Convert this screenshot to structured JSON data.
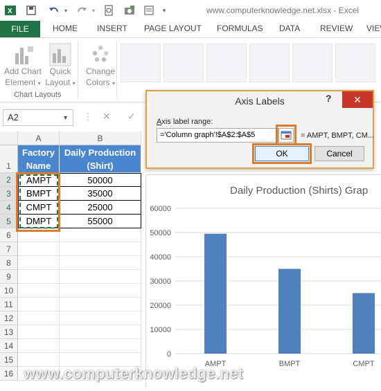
{
  "app": {
    "title": "www.computerknowledge.net.xlsx - Excel"
  },
  "tabs": [
    "FILE",
    "HOME",
    "INSERT",
    "PAGE LAYOUT",
    "FORMULAS",
    "DATA",
    "REVIEW",
    "VIEW"
  ],
  "ribbon": {
    "add_chart": "Add Chart",
    "add_chart_sub": "Element",
    "quick": "Quick",
    "quick_sub": "Layout",
    "change": "Change",
    "change_sub": "Colors",
    "group_label": "Chart Layouts"
  },
  "formula_bar": {
    "name_box": "A2",
    "cancel": "✕",
    "enter": "✓"
  },
  "sheet": {
    "columns": [
      "A",
      "B"
    ],
    "rows": [
      "1",
      "2",
      "3",
      "4",
      "5",
      "6",
      "7",
      "8",
      "9",
      "10",
      "11",
      "12",
      "13",
      "14",
      "15",
      "16"
    ],
    "header": {
      "a_line1": "Factory",
      "a_line2": "Name",
      "b_line1": "Daily Production",
      "b_line2": "(Shirt)"
    },
    "data": [
      {
        "name": "AMPT",
        "value": "50000"
      },
      {
        "name": "BMPT",
        "value": "35000"
      },
      {
        "name": "CMPT",
        "value": "25000"
      },
      {
        "name": "DMPT",
        "value": "55000"
      }
    ]
  },
  "dialog": {
    "title": "Axis Labels",
    "help": "?",
    "close": "✕",
    "label": "Axis label range:",
    "value": "='Column graph'!$A$2:$A$5",
    "preview": "= AMPT, BMPT, CM...",
    "ok": "OK",
    "cancel": "Cancel"
  },
  "chart_data": {
    "type": "bar",
    "title": "Daily Production (Shirts) Grap",
    "categories": [
      "AMPT",
      "BMPT",
      "CMPT"
    ],
    "values": [
      49500,
      35000,
      25000
    ],
    "ylim": [
      0,
      60000
    ],
    "yticks": [
      "0",
      "10000",
      "20000",
      "30000",
      "40000",
      "50000",
      "60000"
    ],
    "grid": true,
    "bar_color": "#4f81bd"
  },
  "watermark": "www.computerknowledge.net",
  "colors": {
    "excel_green": "#217346",
    "header_blue": "#4a86cf",
    "highlight_orange": "#e07b2a"
  }
}
